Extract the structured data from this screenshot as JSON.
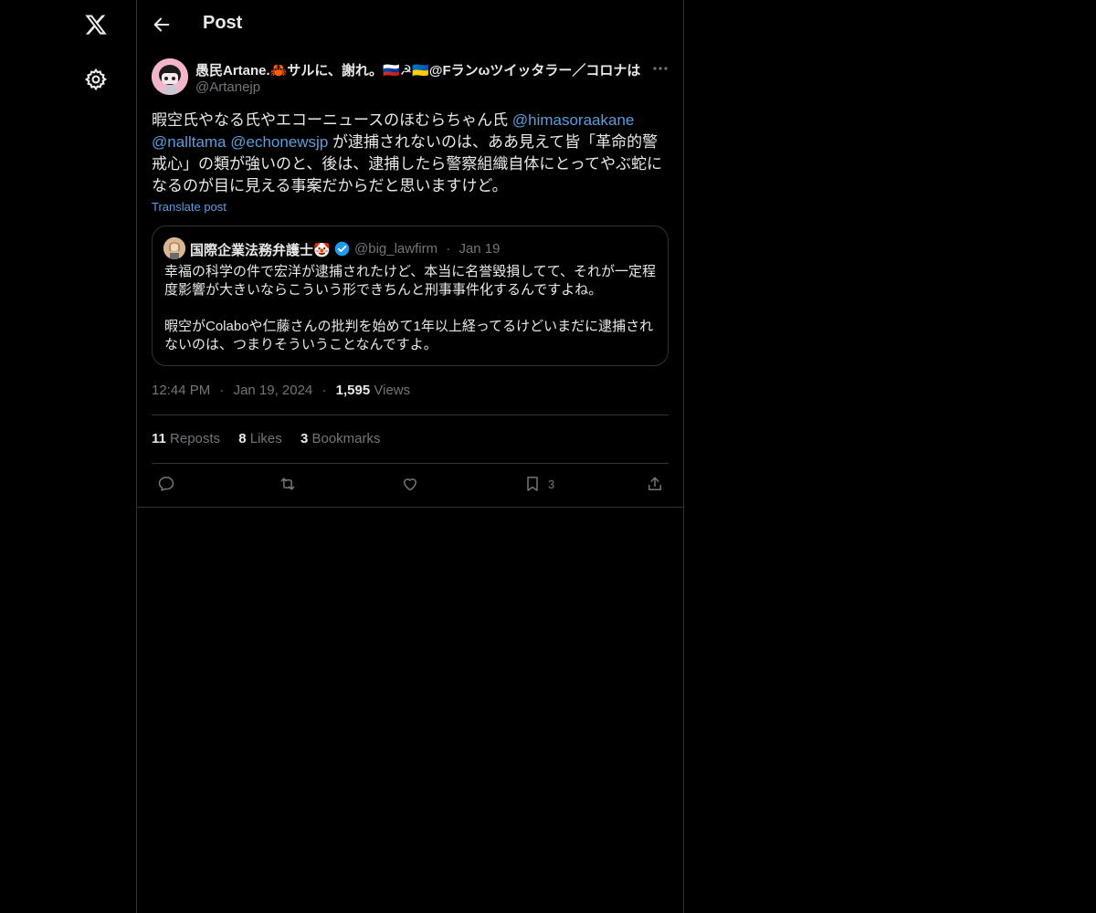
{
  "colors": {
    "background": "#000000",
    "text": "#e7e9ea",
    "muted": "#71767b",
    "link": "#5b9ddf",
    "border": "#2f3336",
    "verified": "#1d9bf0"
  },
  "nav": {
    "logo_icon": "x-logo-icon",
    "settings_icon": "gear-icon"
  },
  "header": {
    "title": "Post",
    "back_icon": "arrow-left-icon"
  },
  "post": {
    "author_name": "愚民Artane.🦀サルに、謝れ。🇷🇺☭🇺🇦@Fランωツイッタラー／コロナは",
    "author_handle": "@Artanejp",
    "more_icon": "ellipsis-icon",
    "text_parts": {
      "p1": "暇空氏やなる氏やエコーニュースのほむらちゃん氏 ",
      "m1": "@himasoraakane",
      "p2": " ",
      "m2": "@nalltama",
      "p3": " ",
      "m3": "@echonewsjp",
      "p4": " が逮捕されないのは、ああ見えて皆「革命的警戒心」の類が強いのと、後は、逮捕したら警察組織自体にとってやぶ蛇になるのが目に見える事案だからだと思いますけど。"
    },
    "translate_label": "Translate post",
    "quote": {
      "name": "国際企業法務弁護士🤡",
      "handle": "@big_lawfirm",
      "sep": "·",
      "date": "Jan 19",
      "text": "幸福の科学の件で宏洋が逮捕されたけど、本当に名誉毀損してて、それが一定程度影響が大きいならこういう形できちんと刑事事件化するんですよね。\n\n暇空がColaboや仁藤さんの批判を始めて1年以上経ってるけどいまだに逮捕されないのは、つまりそういうことなんですよ。"
    },
    "meta": {
      "time": "12:44 PM",
      "sep": "·",
      "date": "Jan 19, 2024",
      "views_count": "1,595",
      "views_label": "Views"
    },
    "stats": {
      "reposts_count": "11",
      "reposts_label": "Reposts",
      "likes_count": "8",
      "likes_label": "Likes",
      "bookmarks_count": "3",
      "bookmarks_label": "Bookmarks"
    },
    "actions": {
      "reply_icon": "reply-icon",
      "repost_icon": "repost-icon",
      "like_icon": "heart-icon",
      "bookmark_icon": "bookmark-icon",
      "bookmark_count": "3",
      "share_icon": "share-icon"
    }
  }
}
